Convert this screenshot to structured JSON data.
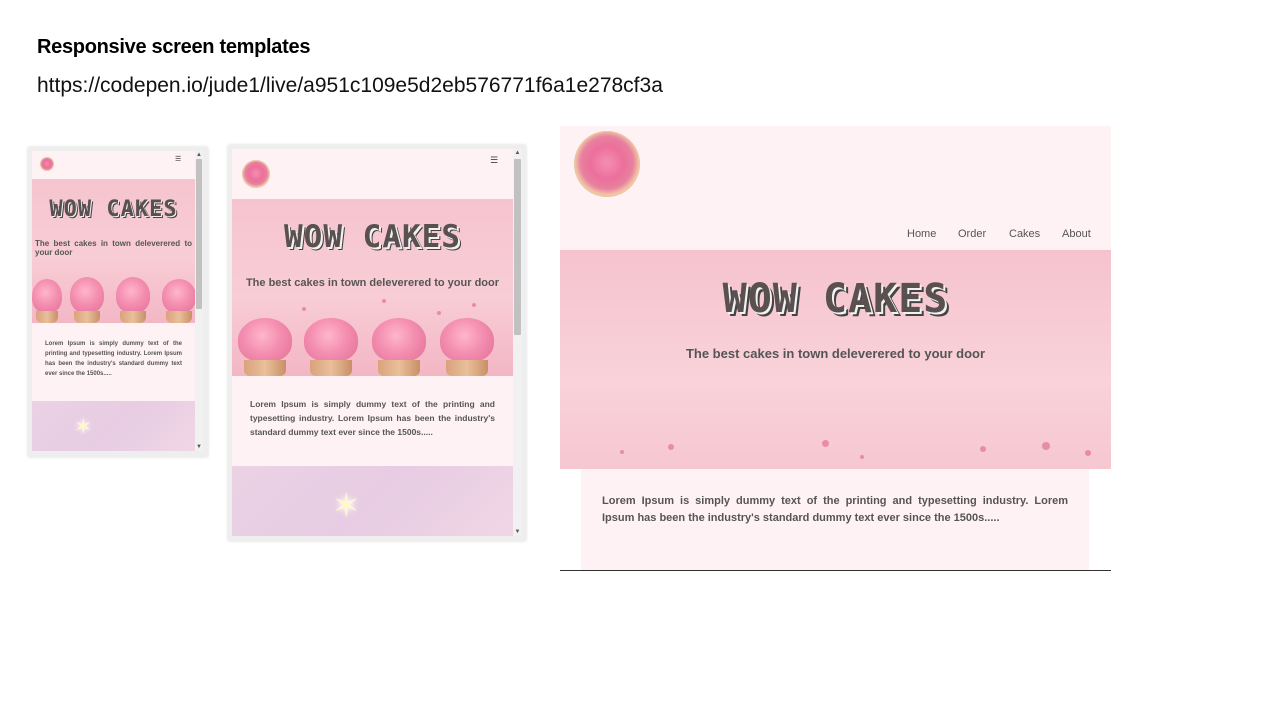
{
  "slide": {
    "title": "Responsive screen templates",
    "url": "https://codepen.io/jude1/live/a951c109e5d2eb576771f6a1e278cf3a"
  },
  "site": {
    "hero_title": "WOW CAKES",
    "tagline_mobile": "The best cakes in town deleverered to your door",
    "tagline": "The best cakes in town deleverered to your door",
    "lorem": "Lorem Ipsum is simply dummy text of the printing and typesetting industry. Lorem Ipsum has been the industry's standard dummy text ever since the 1500s.....",
    "menu_icon": "☰",
    "nav": [
      "Home",
      "Order",
      "Cakes",
      "About"
    ]
  },
  "colors": {
    "nav_bg": "#fff2f5",
    "hero_pink": "#f8cdd6",
    "text_gray": "#555555"
  }
}
